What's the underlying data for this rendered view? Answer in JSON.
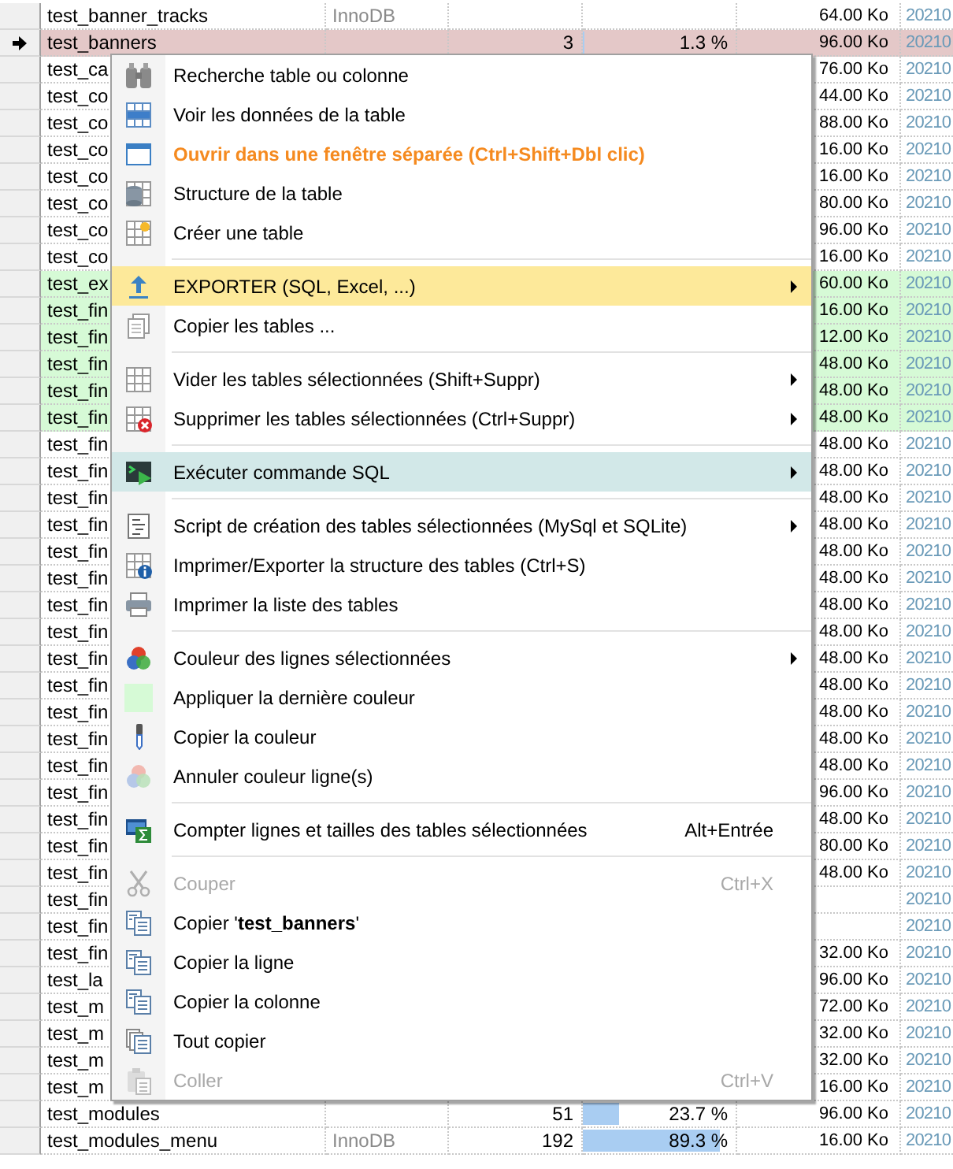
{
  "table": {
    "rows": [
      {
        "name": "test_banner_tracks",
        "engine": "InnoDB",
        "size": "64.00 Ko",
        "date": "20210",
        "selected": false
      },
      {
        "name": "test_banners",
        "count": "3",
        "percent": "1.3 %",
        "level": 0.013,
        "size": "96.00 Ko",
        "date": "20210",
        "selected": true
      },
      {
        "name": "test_ca",
        "size": "76.00 Ko",
        "date": "20210",
        "selected": false
      },
      {
        "name": "test_co",
        "size": "44.00 Ko",
        "date": "20210",
        "selected": false
      },
      {
        "name": "test_co",
        "size": "88.00 Ko",
        "date": "20210",
        "selected": false
      },
      {
        "name": "test_co",
        "size": "16.00 Ko",
        "date": "20210",
        "selected": false
      },
      {
        "name": "test_co",
        "size": "16.00 Ko",
        "date": "20210",
        "selected": false
      },
      {
        "name": "test_co",
        "size": "80.00 Ko",
        "date": "20210",
        "selected": false
      },
      {
        "name": "test_co",
        "size": "96.00 Ko",
        "date": "20210",
        "selected": false
      },
      {
        "name": "test_co",
        "size": "16.00 Ko",
        "date": "20210",
        "selected": false
      },
      {
        "name": "test_ex",
        "size": "60.00 Ko",
        "date": "20210",
        "selected": false,
        "color": "#d6fad6"
      },
      {
        "name": "test_fin",
        "size": "16.00 Ko",
        "date": "20210",
        "selected": false,
        "color": "#d6fad6"
      },
      {
        "name": "test_fin",
        "size": "12.00 Ko",
        "date": "20210",
        "selected": false,
        "color": "#d6fad6"
      },
      {
        "name": "test_fin",
        "size": "48.00 Ko",
        "date": "20210",
        "selected": false,
        "color": "#d6fad6"
      },
      {
        "name": "test_fin",
        "size": "48.00 Ko",
        "date": "20210",
        "selected": false,
        "color": "#d6fad6"
      },
      {
        "name": "test_fin",
        "size": "48.00 Ko",
        "date": "20210",
        "selected": false,
        "color": "#d6fad6"
      },
      {
        "name": "test_fin",
        "size": "48.00 Ko",
        "date": "20210",
        "selected": false
      },
      {
        "name": "test_fin",
        "size": "48.00 Ko",
        "date": "20210",
        "selected": false
      },
      {
        "name": "test_fin",
        "size": "48.00 Ko",
        "date": "20210",
        "selected": false
      },
      {
        "name": "test_fin",
        "size": "48.00 Ko",
        "date": "20210",
        "selected": false
      },
      {
        "name": "test_fin",
        "size": "48.00 Ko",
        "date": "20210",
        "selected": false
      },
      {
        "name": "test_fin",
        "size": "48.00 Ko",
        "date": "20210",
        "selected": false
      },
      {
        "name": "test_fin",
        "size": "48.00 Ko",
        "date": "20210",
        "selected": false
      },
      {
        "name": "test_fin",
        "size": "48.00 Ko",
        "date": "20210",
        "selected": false
      },
      {
        "name": "test_fin",
        "size": "48.00 Ko",
        "date": "20210",
        "selected": false
      },
      {
        "name": "test_fin",
        "size": "48.00 Ko",
        "date": "20210",
        "selected": false
      },
      {
        "name": "test_fin",
        "size": "48.00 Ko",
        "date": "20210",
        "selected": false
      },
      {
        "name": "test_fin",
        "size": "48.00 Ko",
        "date": "20210",
        "selected": false
      },
      {
        "name": "test_fin",
        "size": "48.00 Ko",
        "date": "20210",
        "selected": false
      },
      {
        "name": "test_fin",
        "size": "96.00 Ko",
        "date": "20210",
        "selected": false
      },
      {
        "name": "test_fin",
        "size": "48.00 Ko",
        "date": "20210",
        "selected": false
      },
      {
        "name": "test_fin",
        "size": "80.00 Ko",
        "date": "20210",
        "selected": false
      },
      {
        "name": "test_fin",
        "size": "48.00 Ko",
        "date": "20210",
        "selected": false
      },
      {
        "name": "test_fin",
        "date": "20210",
        "selected": false
      },
      {
        "name": "test_fin",
        "date": "20210",
        "selected": false
      },
      {
        "name": "test_fin",
        "size": "32.00 Ko",
        "date": "20210",
        "selected": false
      },
      {
        "name": "test_la",
        "size": "96.00 Ko",
        "date": "20210",
        "selected": false
      },
      {
        "name": "test_m",
        "size": "72.00 Ko",
        "date": "20210",
        "selected": false
      },
      {
        "name": "test_m",
        "size": "32.00 Ko",
        "date": "20210",
        "selected": false
      },
      {
        "name": "test_m",
        "size": "32.00 Ko",
        "date": "20210",
        "selected": false
      },
      {
        "name": "test_m",
        "size": "16.00 Ko",
        "date": "20210",
        "selected": false
      },
      {
        "name": "test_modules",
        "count": "51",
        "percent": "23.7 %",
        "level": 0.237,
        "size": "96.00 Ko",
        "date": "20210",
        "selected": false
      },
      {
        "name": "test_modules_menu",
        "engine": "InnoDB",
        "count": "192",
        "percent": "89.3 %",
        "level": 0.893,
        "size": "16.00 Ko",
        "date": "20210",
        "selected": false
      }
    ]
  },
  "context_menu": {
    "items": [
      {
        "kind": "item",
        "label": "Recherche table ou colonne",
        "submenu": false,
        "disabled": false,
        "emphasized": false
      },
      {
        "kind": "item",
        "label": "Voir les données de la table",
        "submenu": false,
        "disabled": false,
        "emphasized": false
      },
      {
        "kind": "item",
        "label": "Ouvrir dans une fenêtre séparée (Ctrl+Shift+Dbl clic)",
        "submenu": false,
        "disabled": false,
        "emphasized": true
      },
      {
        "kind": "item",
        "label": "Structure de la table",
        "submenu": false,
        "disabled": false,
        "emphasized": false
      },
      {
        "kind": "item",
        "label": "Créer une table",
        "submenu": false,
        "disabled": false,
        "emphasized": false
      },
      {
        "kind": "separator"
      },
      {
        "kind": "item",
        "label": "EXPORTER (SQL, Excel, ...)",
        "submenu": true,
        "disabled": false,
        "emphasized": false,
        "color": "#fde99a"
      },
      {
        "kind": "item",
        "label": "Copier les tables ...",
        "submenu": false,
        "disabled": false,
        "emphasized": false
      },
      {
        "kind": "separator"
      },
      {
        "kind": "item",
        "label": "Vider les tables sélectionnées (Shift+Suppr)",
        "submenu": true,
        "disabled": false,
        "emphasized": false
      },
      {
        "kind": "item",
        "label": "Supprimer les tables sélectionnées (Ctrl+Suppr)",
        "submenu": true,
        "disabled": false,
        "emphasized": false
      },
      {
        "kind": "separator"
      },
      {
        "kind": "item",
        "label": "Exécuter commande SQL",
        "submenu": true,
        "disabled": false,
        "emphasized": false,
        "color": "#d2e8e8"
      },
      {
        "kind": "separator"
      },
      {
        "kind": "item",
        "label": "Script de création des tables sélectionnées (MySql et SQLite)",
        "submenu": true,
        "disabled": false,
        "emphasized": false
      },
      {
        "kind": "item",
        "label": "Imprimer/Exporter la structure des tables (Ctrl+S)",
        "submenu": false,
        "disabled": false,
        "emphasized": false
      },
      {
        "kind": "item",
        "label": "Imprimer la liste des tables",
        "submenu": false,
        "disabled": false,
        "emphasized": false
      },
      {
        "kind": "separator"
      },
      {
        "kind": "item",
        "label": "Couleur des lignes sélectionnées",
        "submenu": true,
        "disabled": false,
        "emphasized": false
      },
      {
        "kind": "item",
        "label": "Appliquer la dernière couleur",
        "submenu": false,
        "disabled": false,
        "emphasized": false
      },
      {
        "kind": "item",
        "label": "Copier la couleur",
        "submenu": false,
        "disabled": false,
        "emphasized": false
      },
      {
        "kind": "item",
        "label": "Annuler couleur ligne(s)",
        "submenu": false,
        "disabled": false,
        "emphasized": false
      },
      {
        "kind": "separator"
      },
      {
        "kind": "item",
        "label": "Compter lignes et tailles des tables sélectionnées",
        "shortcut": "Alt+Entrée",
        "submenu": false,
        "disabled": false,
        "emphasized": false
      },
      {
        "kind": "separator"
      },
      {
        "kind": "item",
        "label": "Couper",
        "shortcut": "Ctrl+X",
        "submenu": false,
        "disabled": true,
        "emphasized": false
      },
      {
        "kind": "item",
        "label": "Copier '**test_banners**'",
        "submenu": false,
        "disabled": false,
        "emphasized": false
      },
      {
        "kind": "item",
        "label": "Copier la ligne",
        "submenu": false,
        "disabled": false,
        "emphasized": false
      },
      {
        "kind": "item",
        "label": "Copier la colonne",
        "submenu": false,
        "disabled": false,
        "emphasized": false
      },
      {
        "kind": "item",
        "label": "Tout copier",
        "submenu": false,
        "disabled": false,
        "emphasized": false
      },
      {
        "kind": "item",
        "label": "Coller",
        "shortcut": "Ctrl+V",
        "submenu": false,
        "disabled": true,
        "emphasized": false
      }
    ]
  }
}
